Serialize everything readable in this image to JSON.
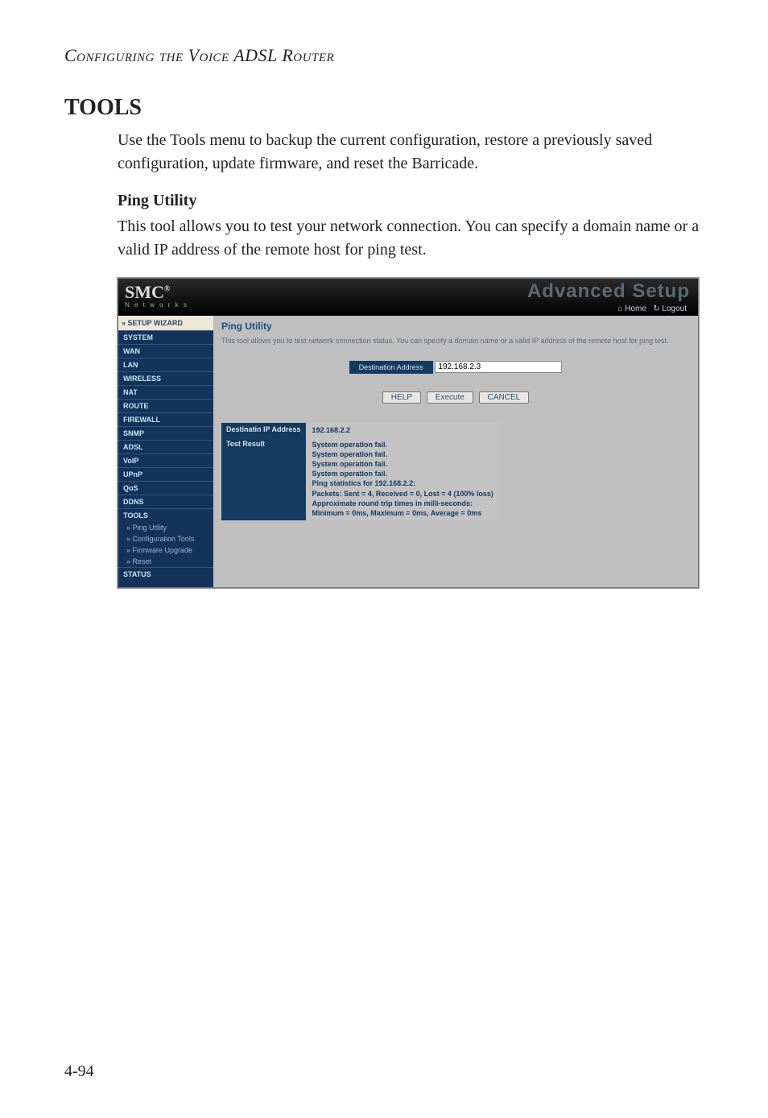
{
  "doc": {
    "running_head": "Configuring the Voice ADSL Router",
    "section_title": "TOOLS",
    "intro": "Use the Tools menu to backup the current configuration, restore a previously saved configuration, update firmware, and reset the Barricade.",
    "sub_title": "Ping Utility",
    "sub_body": "This tool allows you to test your network connection. You can specify a domain name or a valid IP address of the remote host for ping test.",
    "page_number": "4-94"
  },
  "screenshot": {
    "brand": "SMC",
    "brand_sub": "N e t w o r k s",
    "wordmark": "Advanced Setup",
    "top_links": {
      "home": "Home",
      "logout": "Logout"
    },
    "sidebar": {
      "setup_wizard": "» SETUP WIZARD",
      "items": [
        {
          "label": "SYSTEM"
        },
        {
          "label": "WAN"
        },
        {
          "label": "LAN"
        },
        {
          "label": "WIRELESS"
        },
        {
          "label": "NAT"
        },
        {
          "label": "ROUTE"
        },
        {
          "label": "FIREWALL"
        },
        {
          "label": "SNMP"
        },
        {
          "label": "ADSL"
        },
        {
          "label": "VoIP"
        },
        {
          "label": "UPnP"
        },
        {
          "label": "QoS"
        },
        {
          "label": "DDNS"
        },
        {
          "label": "TOOLS"
        }
      ],
      "sub": [
        {
          "label": "» Ping Utility"
        },
        {
          "label": "» Configuration Tools"
        },
        {
          "label": "» Firmware Upgrade"
        },
        {
          "label": "» Reset"
        }
      ],
      "status": "STATUS"
    },
    "main": {
      "title": "Ping Utility",
      "description": "This tool allows you to test network connection status. You can specify a domain name or a valid IP address of the remote host for ping test.",
      "dest_label": "Destination Address",
      "dest_value": "192.168.2.3",
      "buttons": {
        "help": "HELP",
        "execute": "Execute",
        "cancel": "CANCEL"
      },
      "result": {
        "addr_label": "Destinatin IP Address",
        "addr_value": "192.168.2.2",
        "test_label": "Test Result",
        "lines": {
          "l1": "System operation fail.",
          "l2": "System operation fail.",
          "l3": "System operation fail.",
          "l4": "System operation fail.",
          "l5": "Ping statistics for 192.168.2.2:",
          "l6": "Packets: Sent = 4, Received = 0, Lost = 4 (100% loss)",
          "l7": "Approximate round trip times in milli-seconds:",
          "l8": "Minimum = 0ms, Maximum = 0ms, Average = 0ms"
        }
      }
    }
  }
}
